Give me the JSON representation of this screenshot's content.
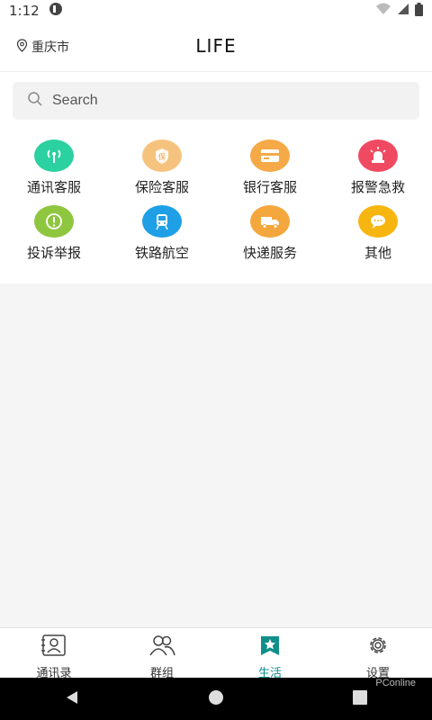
{
  "status": {
    "time": "1:12"
  },
  "header": {
    "location": "重庆市",
    "title": "LIFE"
  },
  "search": {
    "placeholder": "Search"
  },
  "services": [
    {
      "label": "通讯客服",
      "icon": "signal-tower-icon",
      "color": "#2bd1a0"
    },
    {
      "label": "保险客服",
      "icon": "insurance-shield-icon",
      "color": "#f6c37e"
    },
    {
      "label": "银行客服",
      "icon": "bank-card-icon",
      "color": "#f5a947"
    },
    {
      "label": "报警急救",
      "icon": "alarm-light-icon",
      "color": "#f04a62"
    },
    {
      "label": "投诉举报",
      "icon": "exclamation-icon",
      "color": "#8ec63f"
    },
    {
      "label": "铁路航空",
      "icon": "train-icon",
      "color": "#1e9fe6"
    },
    {
      "label": "快递服务",
      "icon": "delivery-truck-icon",
      "color": "#f4a73c"
    },
    {
      "label": "其他",
      "icon": "chat-bubble-icon",
      "color": "#f7b50f"
    }
  ],
  "tabs": [
    {
      "label": "通讯录",
      "icon": "contacts-icon",
      "active": false
    },
    {
      "label": "群组",
      "icon": "group-icon",
      "active": false
    },
    {
      "label": "生活",
      "icon": "life-star-icon",
      "active": true
    },
    {
      "label": "设置",
      "icon": "settings-gear-icon",
      "active": false
    }
  ],
  "watermark": "PConline",
  "accent": "#0f8f8a"
}
